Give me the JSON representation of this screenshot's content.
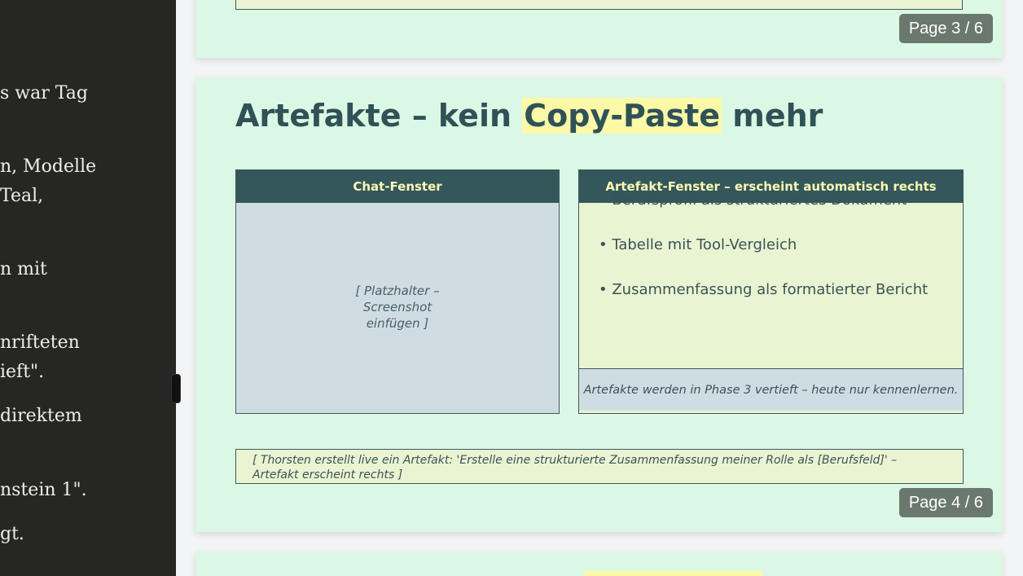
{
  "sidebar": {
    "lines": [
      "s war Tag",
      "n, Modelle",
      "Teal,",
      "n mit",
      "nrifteten",
      "ieft\".",
      "direktem",
      "nstein 1\".",
      "gt."
    ]
  },
  "slides": {
    "prev": {
      "page_label": "Page 3 / 6"
    },
    "current": {
      "title_before": "Artefakte – kein ",
      "title_highlight": "Copy-Paste",
      "title_after": " mehr",
      "chat_panel": {
        "header": "Chat-Fenster",
        "placeholder": "[ Platzhalter – Screenshot einfügen ]"
      },
      "artifact_panel": {
        "header": "Artefakt-Fenster – erscheint automatisch rechts",
        "bullets": [
          "• Berufsprofil als strukturiertes Dokument",
          "• Tabelle mit Tool-Vergleich",
          "• Zusammenfassung als formatierter Bericht"
        ],
        "note": "Artefakte werden in Phase 3 vertieft – heute nur kennenlernen."
      },
      "speaker_note": "[ Thorsten erstellt live ein Artefakt: 'Erstelle eine strukturierte Zusammenfassung meiner Rolle als [Berufsfeld]' – Artefakt erscheint rechts ]",
      "page_label": "Page 4 / 6"
    }
  },
  "colors": {
    "slide_bg": "#dbf8e5",
    "title": "#2f5157",
    "highlight": "#fbf8a8",
    "panel_header": "#34575b",
    "badge": "#6b7870",
    "sidebar_bg": "#262624"
  }
}
